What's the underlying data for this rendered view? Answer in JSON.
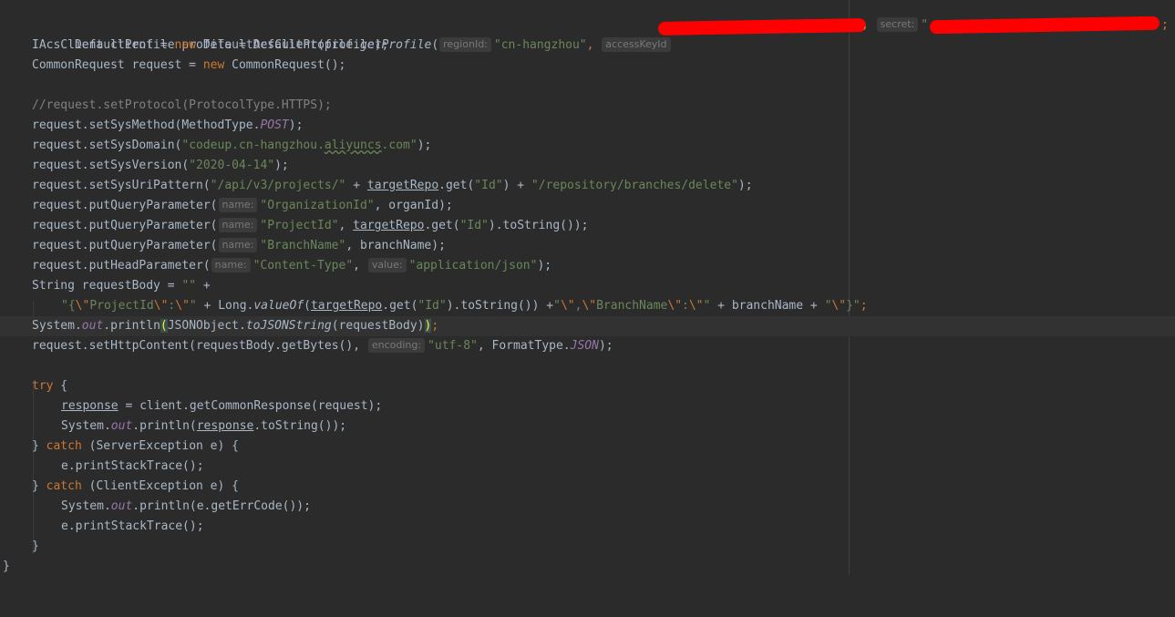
{
  "editor": {
    "lines": {
      "l1": {
        "t1": "DefaultProfile profile = DefaultProfile.",
        "m1": "getProfile",
        "p1": "(",
        "h1": "regionId:",
        "s1": "\"cn-hangzhou\"",
        "c1": ", ",
        "h2": "accessKeyId",
        "c2": ", ",
        "h3": "secret:",
        "s3": "\"",
        "end": ";"
      },
      "l2": {
        "t1": "IAcsClient client = ",
        "k1": "new",
        "t2": " DefaultAcsClient(profile);"
      },
      "l3": {
        "t1": "CommonRequest request = ",
        "k1": "new",
        "t2": " CommonRequest();"
      },
      "l5": {
        "c": "//request.setProtocol(ProtocolType.HTTPS);"
      },
      "l6": {
        "t1": "request.setSysMethod(MethodType.",
        "f1": "POST",
        "t2": ");"
      },
      "l7": {
        "t1": "request.setSysDomain(",
        "s1": "\"codeup.cn-hangzhou.",
        "s2": "aliyuncs",
        "s3": ".com\"",
        "t2": ");"
      },
      "l8": {
        "t1": "request.setSysVersion(",
        "s1": "\"2020-04-14\"",
        "t2": ");"
      },
      "l9": {
        "t1": "request.setSysUriPattern(",
        "s1": "\"/api/v3/projects/\"",
        "t2": " + ",
        "u1": "targetRepo",
        "t3": ".get(",
        "s2": "\"Id\"",
        "t4": ") + ",
        "s3": "\"/repository/branches/delete\"",
        "t5": ");"
      },
      "l10": {
        "t1": "request.putQueryParameter(",
        "h1": "name:",
        "s1": "\"OrganizationId\"",
        "t2": ", organId);"
      },
      "l11": {
        "t1": "request.putQueryParameter(",
        "h1": "name:",
        "s1": "\"ProjectId\"",
        "t2": ", ",
        "u1": "targetRepo",
        "t3": ".get(",
        "s2": "\"Id\"",
        "t4": ").toString());"
      },
      "l12": {
        "t1": "request.putQueryParameter(",
        "h1": "name:",
        "s1": "\"BranchName\"",
        "t2": ", branchName);"
      },
      "l13": {
        "t1": "request.putHeadParameter(",
        "h1": "name:",
        "s1": "\"Content-Type\"",
        "t2": ", ",
        "h2": "value:",
        "s2": "\"application/json\"",
        "t3": ");"
      },
      "l14": {
        "t1": "String requestBody = ",
        "s1": "\"\"",
        "t2": " +"
      },
      "l15": {
        "s1": "\"{",
        "e1": "\\\"",
        "s2": "ProjectId",
        "e2": "\\\"",
        "s3": ":",
        "e3": "\\\"",
        "s4": "\"",
        "t1": " + Long.",
        "i1": "valueOf",
        "t2": "(",
        "u1": "targetRepo",
        "t3": ".get(",
        "s5": "\"Id\"",
        "t4": ").toString()) +",
        "s6": "\"",
        "e4": "\\\"",
        "s7": ",",
        "e5": "\\\"",
        "s8": "BranchName",
        "e6": "\\\"",
        "s9": ":",
        "e7": "\\\"",
        "s10": "\"",
        "t5": " + branchName + ",
        "s11": "\"",
        "e8": "\\\"",
        "s12": "}\"",
        "t6": ";"
      },
      "l16": {
        "t1": "System.",
        "f1": "out",
        "t2": ".println",
        "b1": "(",
        "t3": "JSONObject.",
        "i1": "toJSONString",
        "t4": "(requestBody)",
        "b2": ")",
        "t5": ";"
      },
      "l17": {
        "t1": "request.setHttpContent(requestBody.getBytes(), ",
        "h1": "encoding:",
        "s1": "\"utf-8\"",
        "t2": ", FormatType.",
        "f1": "JSON",
        "t3": ");"
      },
      "l19": {
        "k1": "try",
        "t1": " {"
      },
      "l20": {
        "u1": "response",
        "t1": " = client.getCommonResponse(request);"
      },
      "l21": {
        "t1": "System.",
        "f1": "out",
        "t2": ".println(",
        "u1": "response",
        "t3": ".toString());"
      },
      "l22": {
        "t1": "} ",
        "k1": "catch",
        "t2": " (ServerException e) {"
      },
      "l23": {
        "t1": "e.printStackTrace();"
      },
      "l24": {
        "t1": "} ",
        "k1": "catch",
        "t2": " (ClientException e) {"
      },
      "l25": {
        "t1": "System.",
        "f1": "out",
        "t2": ".println(e.getErrCode());"
      },
      "l26": {
        "t1": "e.printStackTrace();"
      },
      "l27": {
        "t1": "}"
      },
      "l28": {
        "t1": "}"
      }
    }
  },
  "colors": {
    "background": "#2b2b2b",
    "keyword": "#cc7832",
    "string": "#6a8759",
    "comment": "#808080",
    "field": "#9876aa",
    "default_text": "#a9b7c6",
    "redaction": "#ff0000"
  }
}
